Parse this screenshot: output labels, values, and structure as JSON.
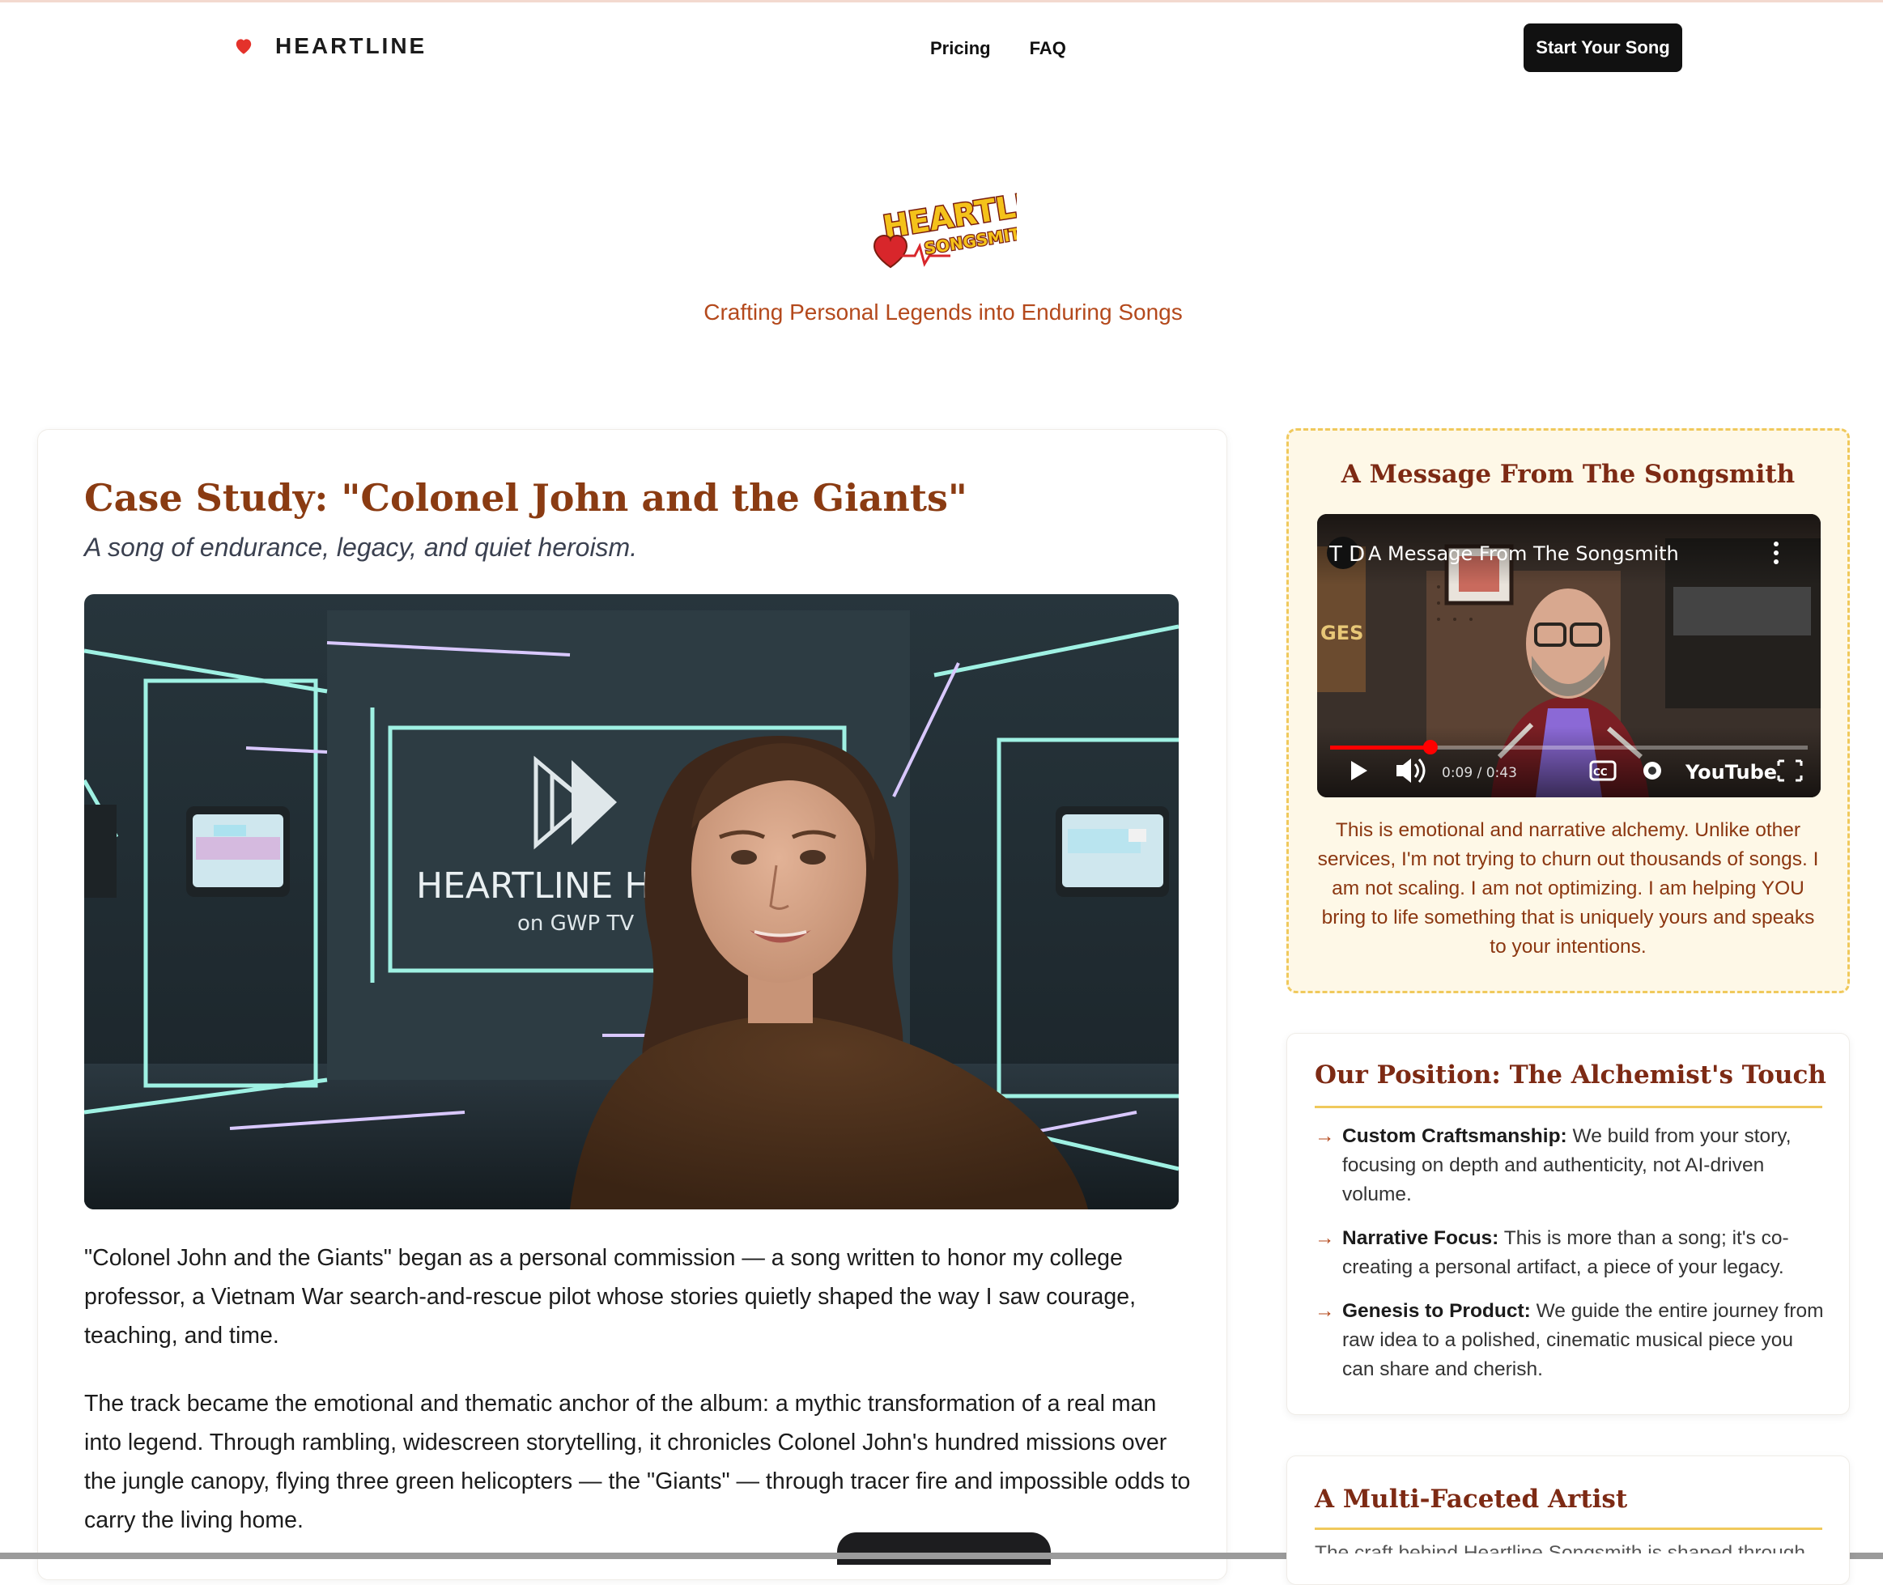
{
  "nav": {
    "brand": "HEARTLINE",
    "links": [
      "Pricing",
      "FAQ"
    ],
    "cta": "Start Your Song"
  },
  "hero": {
    "logo_text_1": "HEARTLINE",
    "logo_text_2": "SONGSMITH",
    "tagline": "Crafting Personal Legends into Enduring Songs"
  },
  "case_study": {
    "title": "Case Study: \"Colonel John and the Giants\"",
    "subtitle": "A song of endurance, legacy, and quiet heroism.",
    "image": {
      "screen_title": "HEARTLINE HITS",
      "screen_subtitle": "on GWP TV"
    },
    "paragraphs": [
      "\"Colonel John and the Giants\" began as a personal commission — a song written to honor my college professor, a Vietnam War search-and-rescue pilot whose stories quietly shaped the way I saw courage, teaching, and time.",
      "The track became the emotional and thematic anchor of the album: a mythic transformation of a real man into legend. Through rambling, widescreen storytelling, it chronicles Colonel John's hundred missions over the jungle canopy, flying three green helicopters — the \"Giants\" — through tracer fire and impossible odds to carry the living home."
    ]
  },
  "songsmith": {
    "title": "A Message From The Songsmith",
    "video": {
      "channel_initials": "T D",
      "title": "A Message From The Songsmith",
      "time": "0:09 / 0:43",
      "progress": 0.21,
      "platform": "YouTube",
      "cc": "CC"
    },
    "message": "This is emotional and narrative alchemy. Unlike other services, I'm not trying to churn out thousands of songs. I am not scaling. I am not optimizing. I am helping YOU bring to life something that is uniquely yours and speaks to your intentions."
  },
  "position": {
    "title": "Our Position: The Alchemist's Touch",
    "items": [
      {
        "label": "Custom Craftsmanship:",
        "text": " We build from your story, focusing on depth and authenticity, not AI-driven volume."
      },
      {
        "label": "Narrative Focus:",
        "text": " This is more than a song; it's co-creating a personal artifact, a piece of your legacy."
      },
      {
        "label": "Genesis to Product:",
        "text": " We guide the entire journey from raw idea to a polished, cinematic musical piece you can share and cherish."
      }
    ]
  },
  "artist": {
    "title": "A Multi-Faceted Artist",
    "cut_text": "The craft behind Heartline Songsmith is shaped through"
  },
  "colors": {
    "accent_brown": "#8a3b12",
    "accent_orange": "#b4491c",
    "gold": "#f0c95c",
    "cream": "#fef8e7",
    "youtube_red": "#ff0000"
  }
}
